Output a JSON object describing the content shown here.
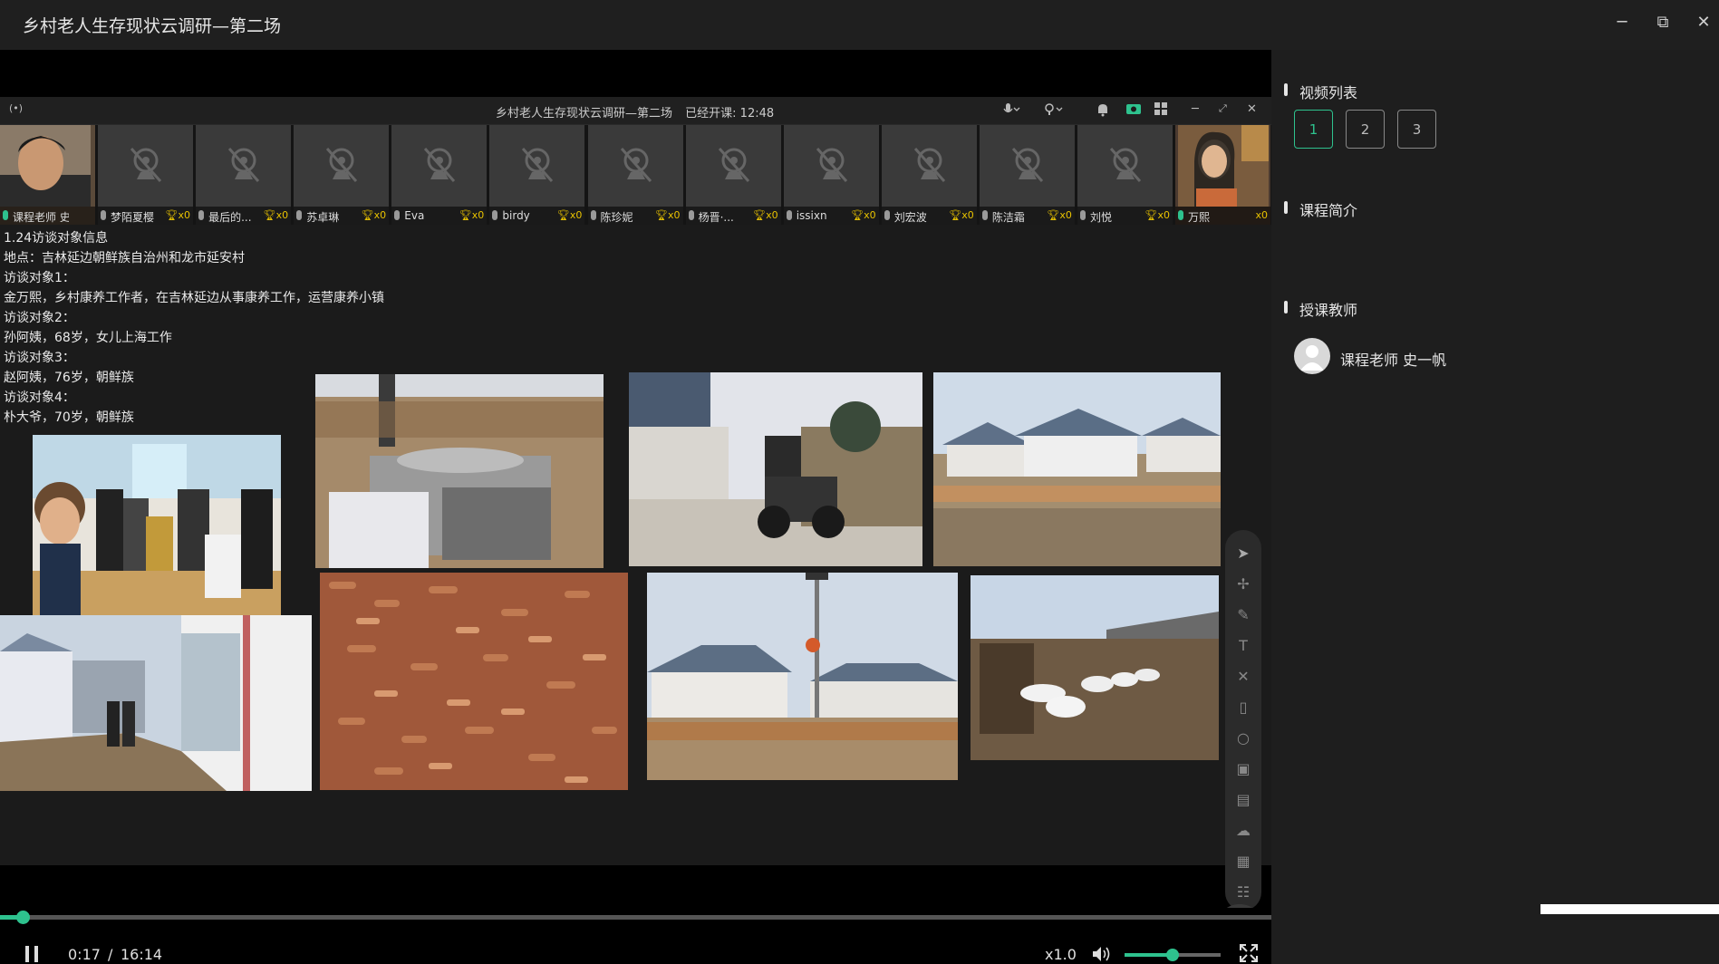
{
  "window": {
    "title": "乡村老人生存现状云调研—第二场",
    "minimize": "─",
    "restore": "⧉",
    "close": "✕"
  },
  "meeting": {
    "title": "乡村老人生存现状云调研—第二场",
    "elapsed": "已经开课: 12:48",
    "signal_icon": "(•)",
    "mic_icon": "🎤︎",
    "cam_icon": "⚲"
  },
  "participants": [
    {
      "name": "课程老师 史...",
      "trophy": "",
      "video": true
    },
    {
      "name": "梦陌夏樱",
      "trophy": "x0",
      "video": false
    },
    {
      "name": "最后的...",
      "trophy": "x0",
      "video": false
    },
    {
      "name": "苏卓琳",
      "trophy": "x0",
      "video": false
    },
    {
      "name": "Eva",
      "trophy": "x0",
      "video": false
    },
    {
      "name": "birdy",
      "trophy": "x0",
      "video": false
    },
    {
      "name": "陈珍妮",
      "trophy": "x0",
      "video": false
    },
    {
      "name": "杨晋·...",
      "trophy": "x0",
      "video": false
    },
    {
      "name": "issixn",
      "trophy": "x0",
      "video": false
    },
    {
      "name": "刘宏波",
      "trophy": "x0",
      "video": false
    },
    {
      "name": "陈洁霜",
      "trophy": "x0",
      "video": false
    },
    {
      "name": "刘悦",
      "trophy": "x0",
      "video": false
    },
    {
      "name": "万熙",
      "trophy": "x0",
      "video": true
    }
  ],
  "slide": {
    "lines": [
      "1.24访谈对象信息",
      "地点：吉林延边朝鲜族自治州和龙市延安村",
      "访谈对象1：",
      "金万熙，乡村康养工作者，在吉林延边从事康养工作，运营康养小镇",
      "访谈对象2：",
      "孙阿姨，68岁，女儿上海工作",
      "访谈对象3：",
      "赵阿姨，76岁，朝鲜族",
      "访谈对象4：",
      "朴大爷，70岁，朝鲜族"
    ]
  },
  "player": {
    "current_time": "0:17",
    "separator": "/",
    "total_time": "16:14",
    "speed": "x1.0",
    "progress": 0.0176,
    "volume": 0.5
  },
  "sidebar": {
    "video_list_title": "视频列表",
    "videos": [
      "1",
      "2",
      "3"
    ],
    "active_video": "1",
    "intro_title": "课程简介",
    "teacher_title": "授课教师",
    "teacher_name": "课程老师 史一帆"
  },
  "colors": {
    "accent": "#2ec28e",
    "background": "#1e1e1e"
  }
}
